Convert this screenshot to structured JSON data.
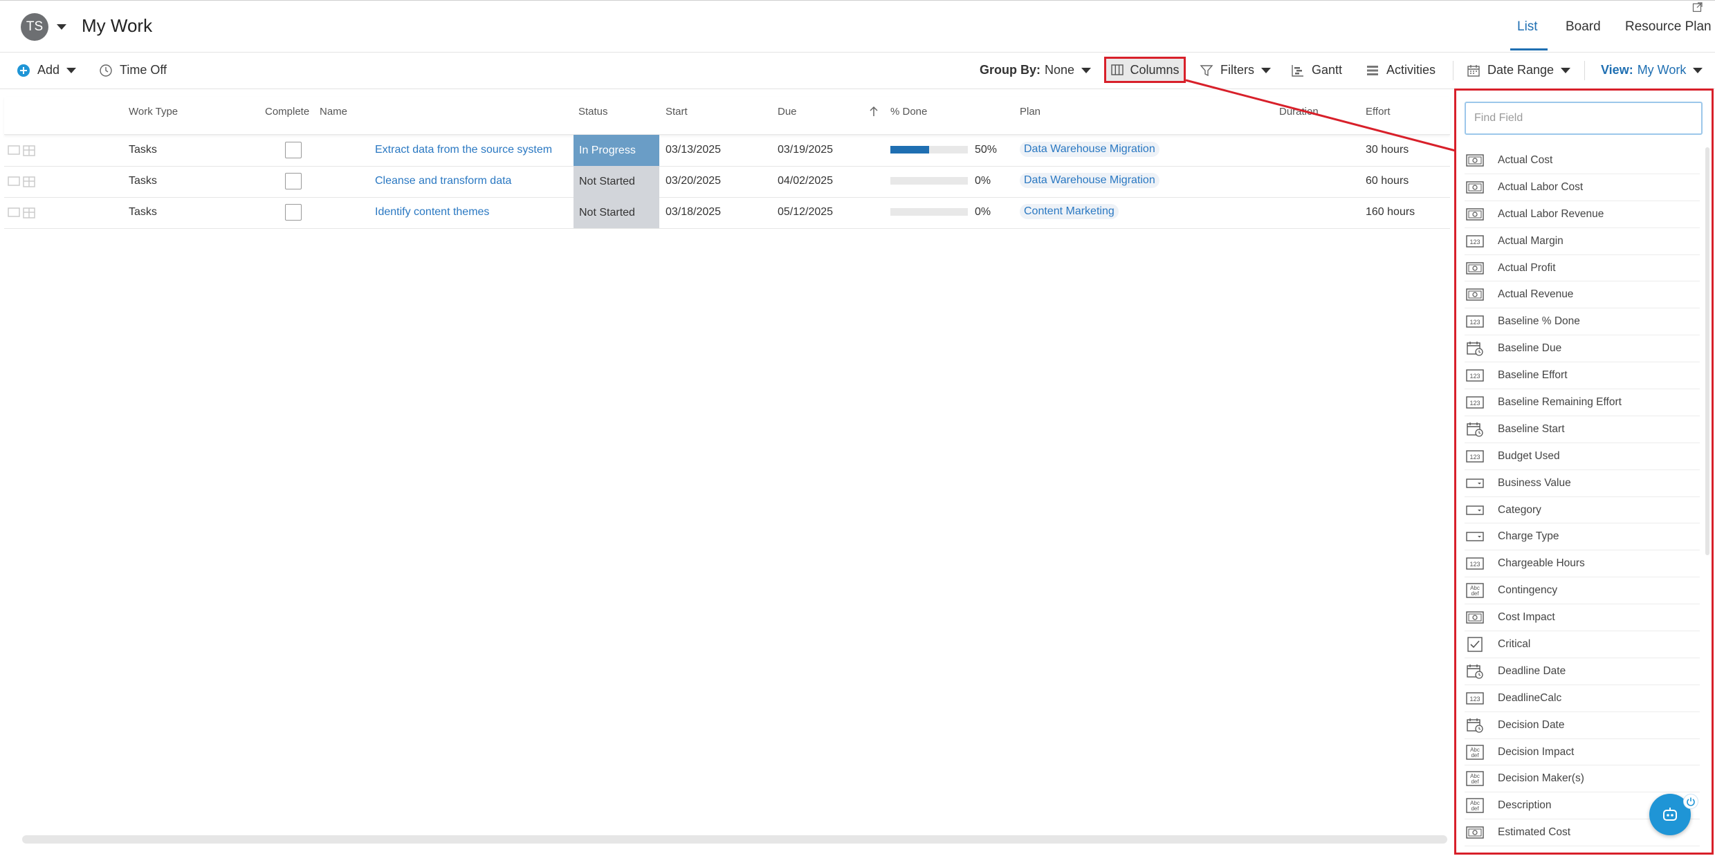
{
  "header": {
    "avatar_initials": "TS",
    "title": "My Work",
    "view_tabs": [
      {
        "label": "List",
        "active": true
      },
      {
        "label": "Board",
        "active": false
      },
      {
        "label": "Resource Plan",
        "active": false
      }
    ]
  },
  "toolbar": {
    "add_label": "Add",
    "time_off_label": "Time Off",
    "group_by_label": "Group By:",
    "group_by_value": "None",
    "columns_label": "Columns",
    "filters_label": "Filters",
    "gantt_label": "Gantt",
    "activities_label": "Activities",
    "date_range_label": "Date Range",
    "view_label": "View:",
    "view_value": "My Work"
  },
  "grid": {
    "columns": [
      "Work Type",
      "Complete",
      "Name",
      "Status",
      "Start",
      "Due",
      "% Done",
      "Plan",
      "Duration",
      "Effort"
    ],
    "rows": [
      {
        "work_type": "Tasks",
        "name": "Extract data from the source system",
        "status": "In Progress",
        "start": "03/13/2025",
        "due": "03/19/2025",
        "pct_done": "50%",
        "pct_value": 50,
        "plan": "Data Warehouse Migration",
        "effort": "30 hours"
      },
      {
        "work_type": "Tasks",
        "name": "Cleanse and transform data",
        "status": "Not Started",
        "start": "03/20/2025",
        "due": "04/02/2025",
        "pct_done": "0%",
        "pct_value": 0,
        "plan": "Data Warehouse Migration",
        "effort": "60 hours"
      },
      {
        "work_type": "Tasks",
        "name": "Identify content themes",
        "status": "Not Started",
        "start": "03/18/2025",
        "due": "05/12/2025",
        "pct_done": "0%",
        "pct_value": 0,
        "plan": "Content Marketing",
        "effort": "160 hours"
      }
    ]
  },
  "columns_panel": {
    "search_placeholder": "Find Field",
    "fields": [
      {
        "label": "Actual Cost",
        "icon": "currency"
      },
      {
        "label": "Actual Labor Cost",
        "icon": "currency"
      },
      {
        "label": "Actual Labor Revenue",
        "icon": "currency"
      },
      {
        "label": "Actual Margin",
        "icon": "number"
      },
      {
        "label": "Actual Profit",
        "icon": "currency"
      },
      {
        "label": "Actual Revenue",
        "icon": "currency"
      },
      {
        "label": "Baseline % Done",
        "icon": "number"
      },
      {
        "label": "Baseline Due",
        "icon": "date"
      },
      {
        "label": "Baseline Effort",
        "icon": "number"
      },
      {
        "label": "Baseline Remaining Effort",
        "icon": "number"
      },
      {
        "label": "Baseline Start",
        "icon": "date"
      },
      {
        "label": "Budget Used",
        "icon": "number"
      },
      {
        "label": "Business Value",
        "icon": "dropdown"
      },
      {
        "label": "Category",
        "icon": "dropdown"
      },
      {
        "label": "Charge Type",
        "icon": "dropdown"
      },
      {
        "label": "Chargeable Hours",
        "icon": "number"
      },
      {
        "label": "Contingency",
        "icon": "text"
      },
      {
        "label": "Cost Impact",
        "icon": "currency"
      },
      {
        "label": "Critical",
        "icon": "checkbox"
      },
      {
        "label": "Deadline Date",
        "icon": "date"
      },
      {
        "label": "DeadlineCalc",
        "icon": "number"
      },
      {
        "label": "Decision Date",
        "icon": "date"
      },
      {
        "label": "Decision Impact",
        "icon": "text"
      },
      {
        "label": "Decision Maker(s)",
        "icon": "text"
      },
      {
        "label": "Description",
        "icon": "text"
      },
      {
        "label": "Estimated Cost",
        "icon": "currency"
      }
    ]
  },
  "colors": {
    "accent": "#1f6fb2",
    "highlight_border": "#d8202a",
    "in_progress_bg": "#6a9dc6",
    "not_started_bg": "#d2d5da"
  }
}
